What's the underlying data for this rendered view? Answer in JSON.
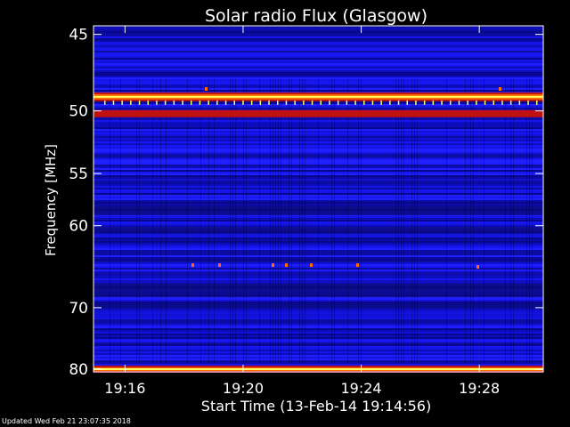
{
  "chart_data": {
    "type": "heatmap",
    "title": "Solar radio Flux (Glasgow)",
    "xlabel": "Start Time (13-Feb-14 19:14:56)",
    "ylabel": "Frequency [MHz]",
    "x_ticks": [
      "19:16",
      "19:20",
      "19:24",
      "19:28"
    ],
    "y_ticks": [
      "45",
      "50",
      "55",
      "60",
      "70",
      "80"
    ],
    "y_scale": "reciprocal",
    "xlim": [
      "19:14:56",
      "19:30:10"
    ],
    "ylim": [
      44.5,
      80.5
    ],
    "bright_bands_mhz": [
      49,
      50.2,
      80
    ],
    "colormap": [
      "#000000",
      "#0a0a7a",
      "#1a1aff",
      "#c01010",
      "#ff6a00",
      "#ffff60"
    ],
    "grid": false
  },
  "footer": "Updated Wed Feb 21 23:07:35 2018"
}
